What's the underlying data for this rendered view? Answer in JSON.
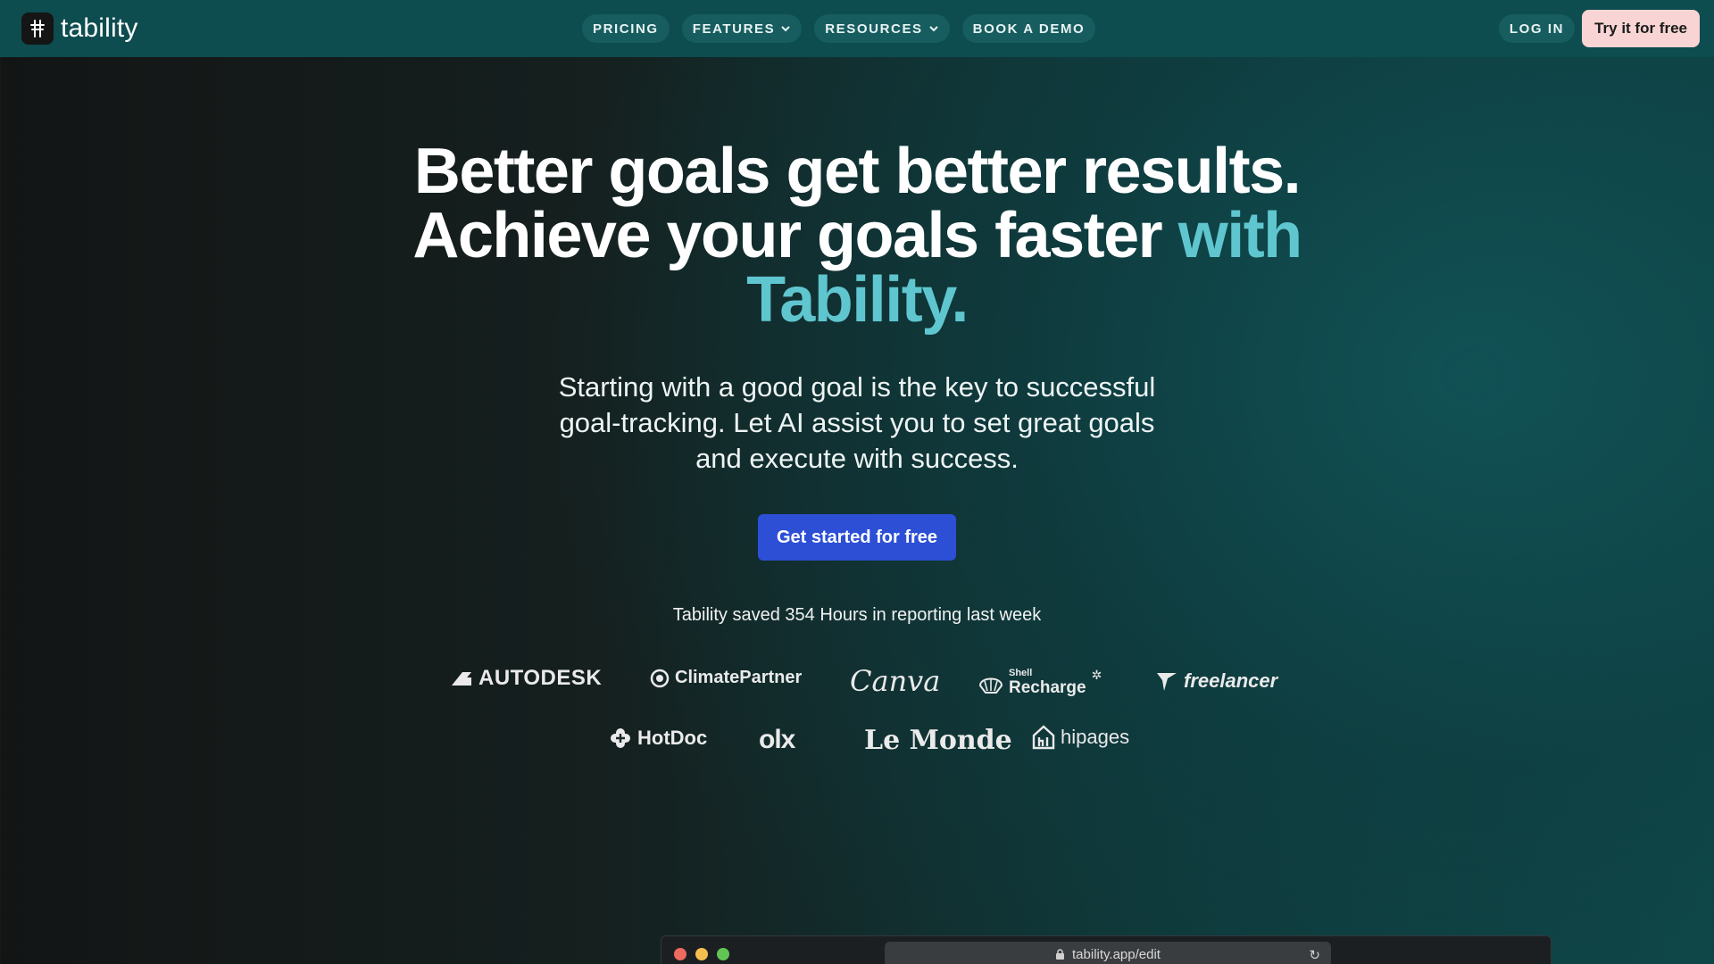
{
  "brand": {
    "name": "tability"
  },
  "nav": {
    "items": [
      {
        "label": "PRICING",
        "dropdown": false
      },
      {
        "label": "FEATURES",
        "dropdown": true
      },
      {
        "label": "RESOURCES",
        "dropdown": true
      },
      {
        "label": "BOOK A DEMO",
        "dropdown": false
      }
    ],
    "login_label": "LOG IN",
    "try_label": "Try it for free"
  },
  "hero": {
    "headline_main": "Better goals get better results. Achieve your goals faster ",
    "headline_accent": "with Tability.",
    "subhead": "Starting with a good goal is the key to successful goal-tracking. Let AI assist you to set great goals and execute with success.",
    "cta_label": "Get started for free",
    "saved_text": "Tability saved 354 Hours in reporting last week"
  },
  "logos": {
    "autodesk": "AUTODESK",
    "climatepartner": "ClimatePartner",
    "canva": "Canva",
    "shell_small": "Shell",
    "shell_big": "Recharge",
    "freelancer": "freelancer",
    "hotdoc": "HotDoc",
    "olx": "olx",
    "lemonde": "Le Monde",
    "hipages": "hipages"
  },
  "browser": {
    "url": "tability.app/edit"
  },
  "colors": {
    "nav_bg": "#0d4c4f",
    "accent_text": "#5fc6cf",
    "cta_bg": "#2c4fd6",
    "try_bg": "#f8d4d4"
  }
}
